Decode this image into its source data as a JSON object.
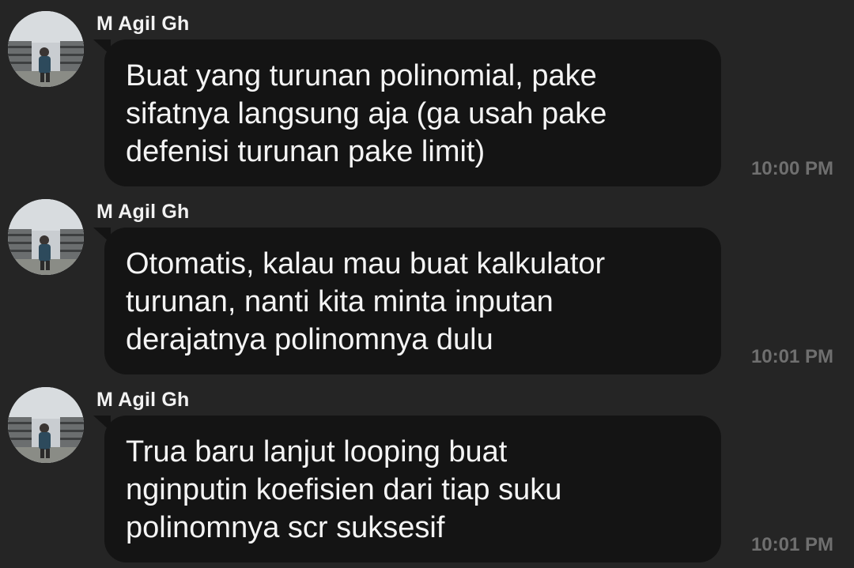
{
  "messages": [
    {
      "sender": "M Agil Gh",
      "text": "Buat yang turunan polinomial, pake\nsifatnya langsung aja (ga usah pake\ndefenisi turunan pake limit)",
      "time": "10:00 PM",
      "avatar_icon": "profile-photo"
    },
    {
      "sender": "M Agil Gh",
      "text": "Otomatis, kalau mau buat kalkulator\nturunan, nanti kita minta inputan\nderajatnya polinomnya dulu",
      "time": "10:01 PM",
      "avatar_icon": "profile-photo"
    },
    {
      "sender": "M Agil Gh",
      "text": "Trua baru lanjut looping buat\nnginputin koefisien dari tiap suku\npolinomnya scr suksesif",
      "time": "10:01 PM",
      "avatar_icon": "profile-photo"
    }
  ],
  "colors": {
    "background": "#252525",
    "bubble": "#141414",
    "text": "#f4f4f4",
    "timestamp": "#6f6f6f"
  }
}
